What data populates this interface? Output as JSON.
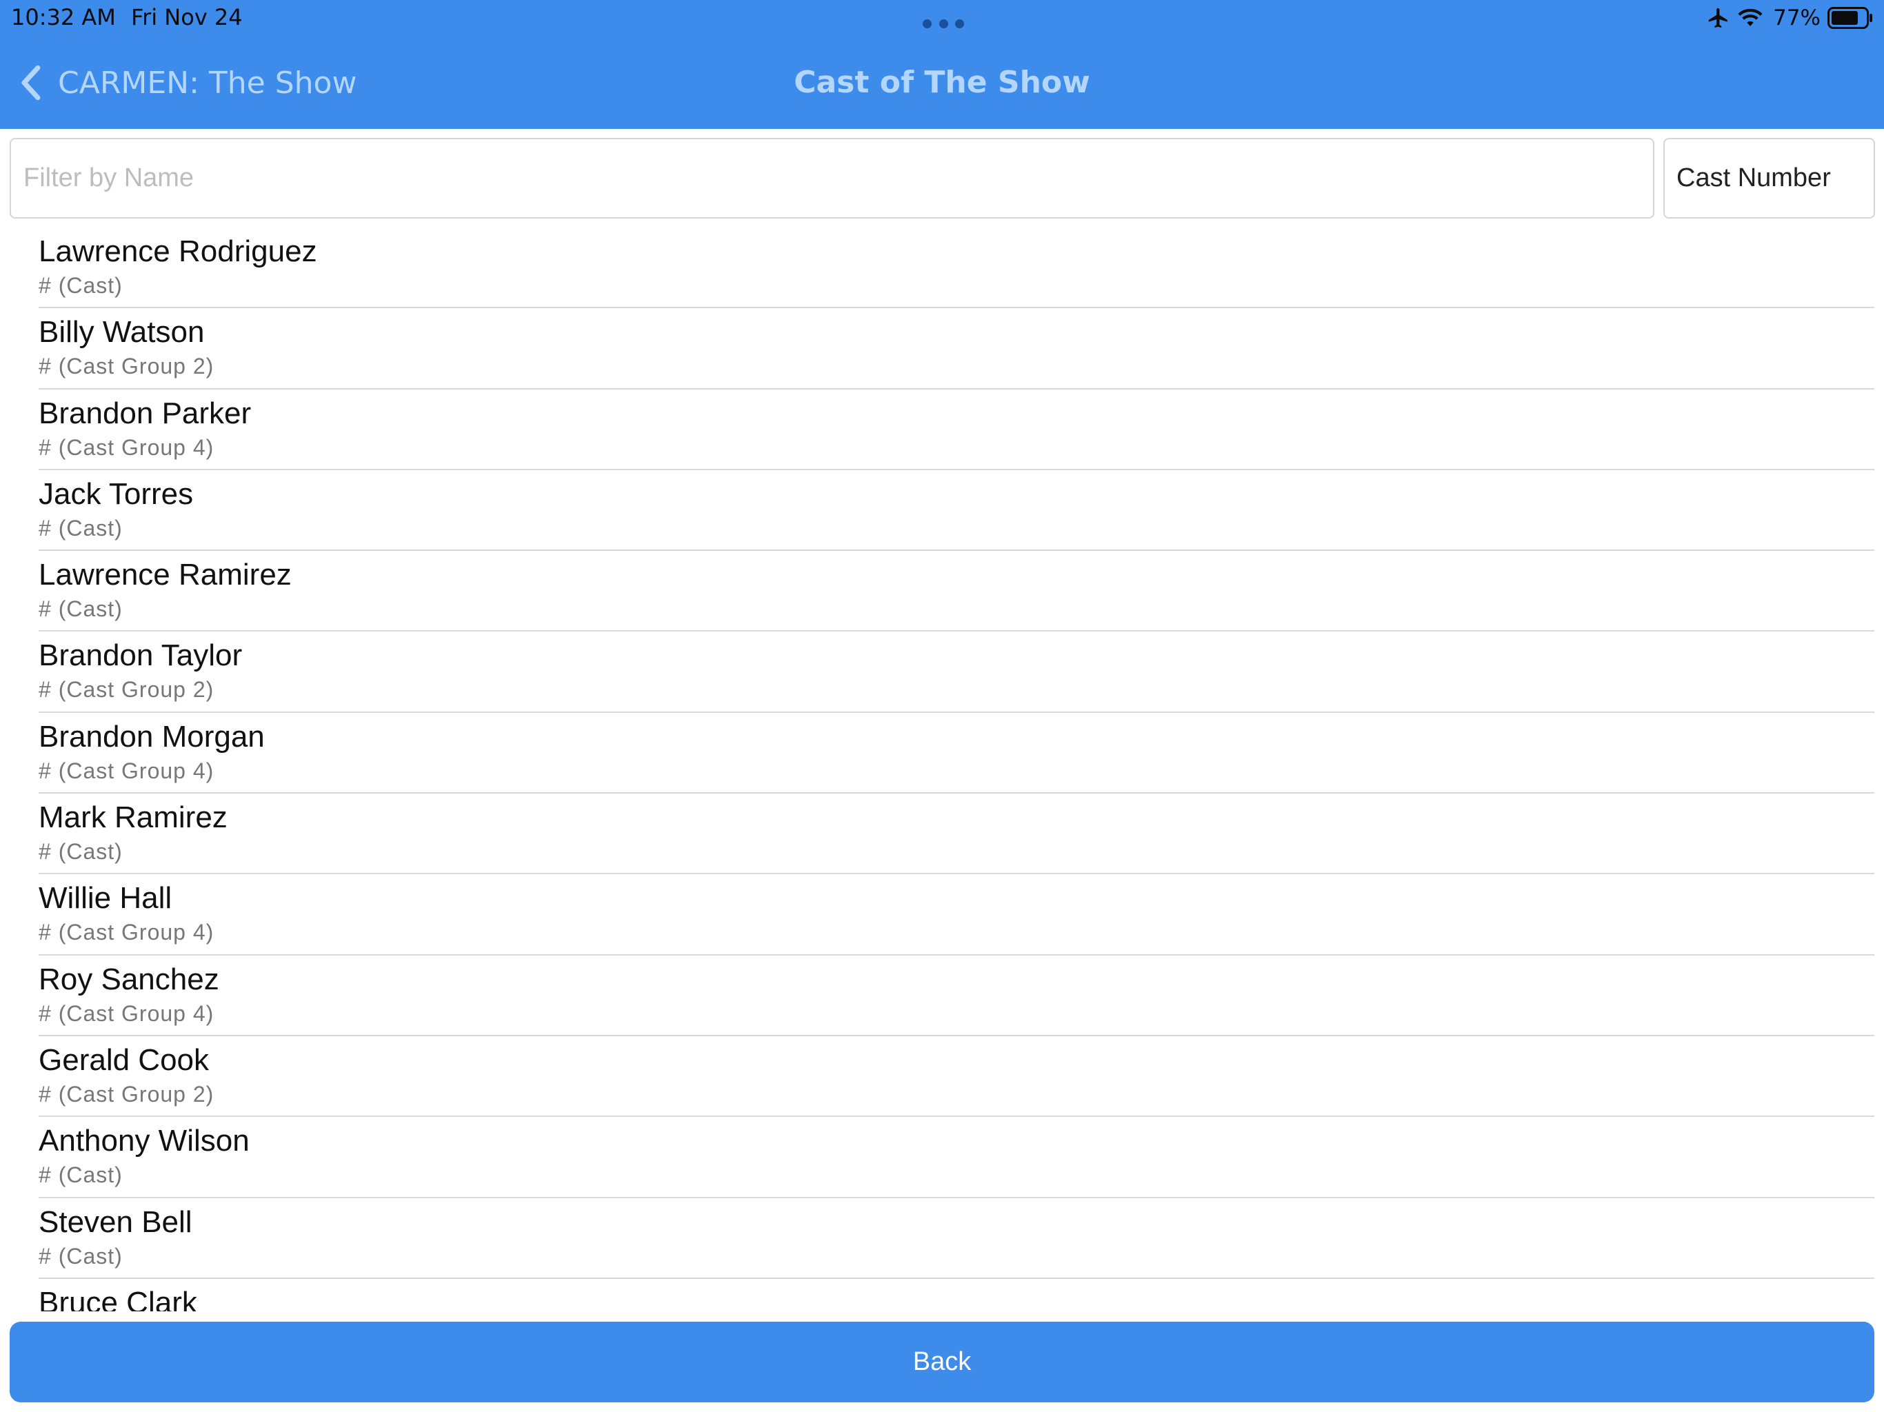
{
  "status_bar": {
    "time": "10:32 AM",
    "date": "Fri Nov 24",
    "battery_percent": "77%",
    "icons": [
      "airplane-icon",
      "wifi-icon",
      "battery-icon"
    ]
  },
  "nav": {
    "back_label": "CARMEN: The Show",
    "title": "Cast of The Show"
  },
  "filter": {
    "placeholder": "Filter by Name",
    "value": "",
    "sort_selected": "Cast Number"
  },
  "cast": [
    {
      "name": "Lawrence Rodriguez",
      "group": "# (Cast)"
    },
    {
      "name": "Billy Watson",
      "group": "# (Cast Group 2)"
    },
    {
      "name": "Brandon Parker",
      "group": "# (Cast Group 4)"
    },
    {
      "name": "Jack Torres",
      "group": "# (Cast)"
    },
    {
      "name": "Lawrence Ramirez",
      "group": "# (Cast)"
    },
    {
      "name": "Brandon Taylor",
      "group": "# (Cast Group 2)"
    },
    {
      "name": "Brandon Morgan",
      "group": "# (Cast Group 4)"
    },
    {
      "name": "Mark Ramirez",
      "group": "# (Cast)"
    },
    {
      "name": "Willie Hall",
      "group": "# (Cast Group 4)"
    },
    {
      "name": "Roy Sanchez",
      "group": "# (Cast Group 4)"
    },
    {
      "name": "Gerald Cook",
      "group": "# (Cast Group 2)"
    },
    {
      "name": "Anthony Wilson",
      "group": "# (Cast)"
    },
    {
      "name": "Steven Bell",
      "group": "# (Cast)"
    },
    {
      "name": "Bruce Clark",
      "group": ""
    }
  ],
  "footer": {
    "back_button_label": "Back"
  },
  "colors": {
    "accent": "#3d8beb",
    "nav_text": "#b5d6fb",
    "separator": "#d9d9d9"
  }
}
